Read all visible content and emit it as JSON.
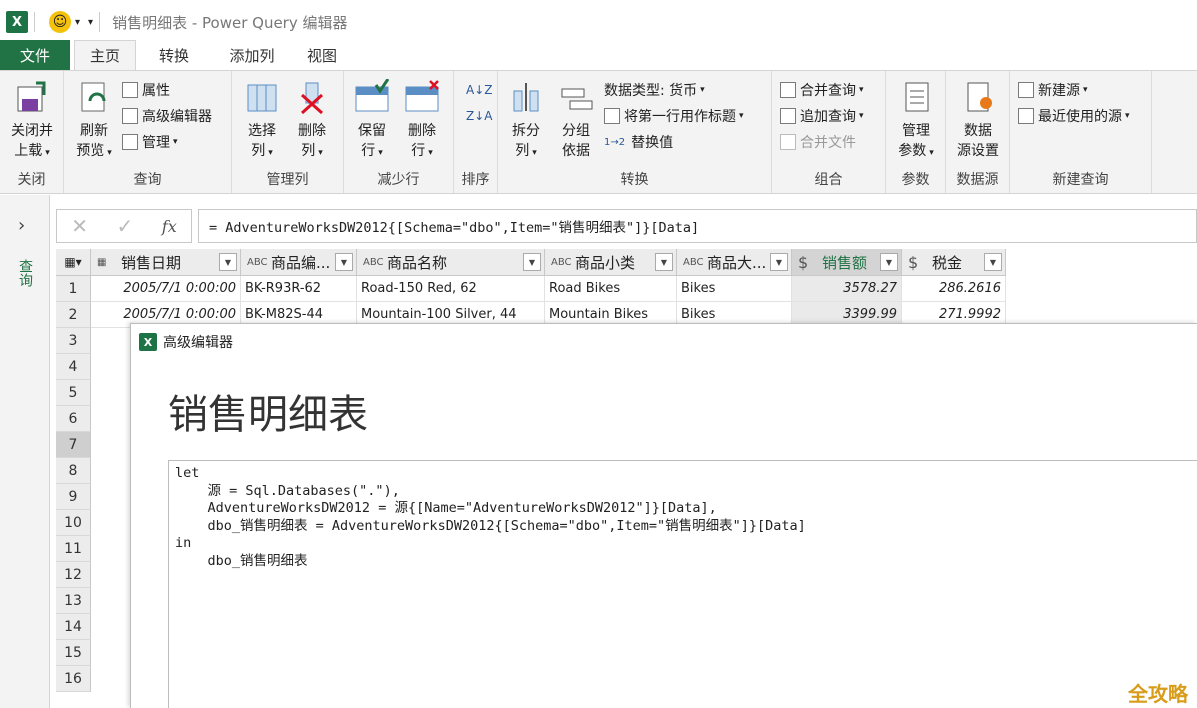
{
  "window": {
    "title": "销售明细表 - Power Query 编辑器",
    "app_icon": "X"
  },
  "tabs": [
    "文件",
    "主页",
    "转换",
    "添加列",
    "视图"
  ],
  "ribbon": {
    "close": {
      "btn": [
        "关闭并",
        "上载"
      ],
      "label": "关闭"
    },
    "query": {
      "refresh": [
        "刷新",
        "预览"
      ],
      "properties": "属性",
      "advanced_editor": "高级编辑器",
      "manage": "管理",
      "label": "查询"
    },
    "manage_cols": {
      "choose": [
        "选择",
        "列"
      ],
      "remove": [
        "删除",
        "列"
      ],
      "label": "管理列"
    },
    "reduce_rows": {
      "keep": [
        "保留",
        "行"
      ],
      "remove": [
        "删除",
        "行"
      ],
      "label": "减少行"
    },
    "sort": {
      "label": "排序"
    },
    "transform": {
      "split": [
        "拆分",
        "列"
      ],
      "group": [
        "分组",
        "依据"
      ],
      "datatype": "数据类型: 货币",
      "first_row": "将第一行用作标题",
      "replace": "替换值",
      "label": "转换"
    },
    "combine": {
      "merge": "合并查询",
      "append": "追加查询",
      "combine_files": "合并文件",
      "label": "组合"
    },
    "params": {
      "btn": [
        "管理",
        "参数"
      ],
      "label": "参数"
    },
    "datasource": {
      "btn": [
        "数据",
        "源设置"
      ],
      "label": "数据源"
    },
    "newquery": {
      "new_source": "新建源",
      "recent": "最近使用的源",
      "label": "新建查询"
    }
  },
  "left_pane": {
    "label": "查询"
  },
  "formula_bar": {
    "cancel": "✕",
    "confirm": "✓",
    "fx": "fx",
    "formula": "= AdventureWorksDW2012{[Schema=\"dbo\",Item=\"销售明细表\"]}[Data]"
  },
  "grid": {
    "columns": [
      {
        "type": "▦",
        "name": "销售日期"
      },
      {
        "type": "ABC",
        "name": "商品编..."
      },
      {
        "type": "ABC",
        "name": "商品名称"
      },
      {
        "type": "ABC",
        "name": "商品小类"
      },
      {
        "type": "ABC",
        "name": "商品大..."
      },
      {
        "type": "$",
        "name": "销售额"
      },
      {
        "type": "$",
        "name": "税金"
      }
    ],
    "rows": [
      [
        "2005/7/1 0:00:00",
        "BK-R93R-62",
        "Road-150 Red, 62",
        "Road Bikes",
        "Bikes",
        "3578.27",
        "286.2616"
      ],
      [
        "2005/7/1 0:00:00",
        "BK-M82S-44",
        "Mountain-100 Silver, 44",
        "Mountain Bikes",
        "Bikes",
        "3399.99",
        "271.9992"
      ]
    ],
    "row_numbers": [
      "1",
      "2",
      "3",
      "4",
      "5",
      "6",
      "7",
      "8",
      "9",
      "10",
      "11",
      "12",
      "13",
      "14",
      "15",
      "16"
    ]
  },
  "dialog": {
    "header": "高级编辑器",
    "title": "销售明细表",
    "code": "let\n    源 = Sql.Databases(\".\"),\n    AdventureWorksDW2012 = 源{[Name=\"AdventureWorksDW2012\"]}[Data],\n    dbo_销售明细表 = AdventureWorksDW2012{[Schema=\"dbo\",Item=\"销售明细表\"]}[Data]\nin\n    dbo_销售明细表"
  },
  "watermark": "全攻略",
  "colors": {
    "accent": "#217346",
    "watermark": "#d89c1a"
  }
}
